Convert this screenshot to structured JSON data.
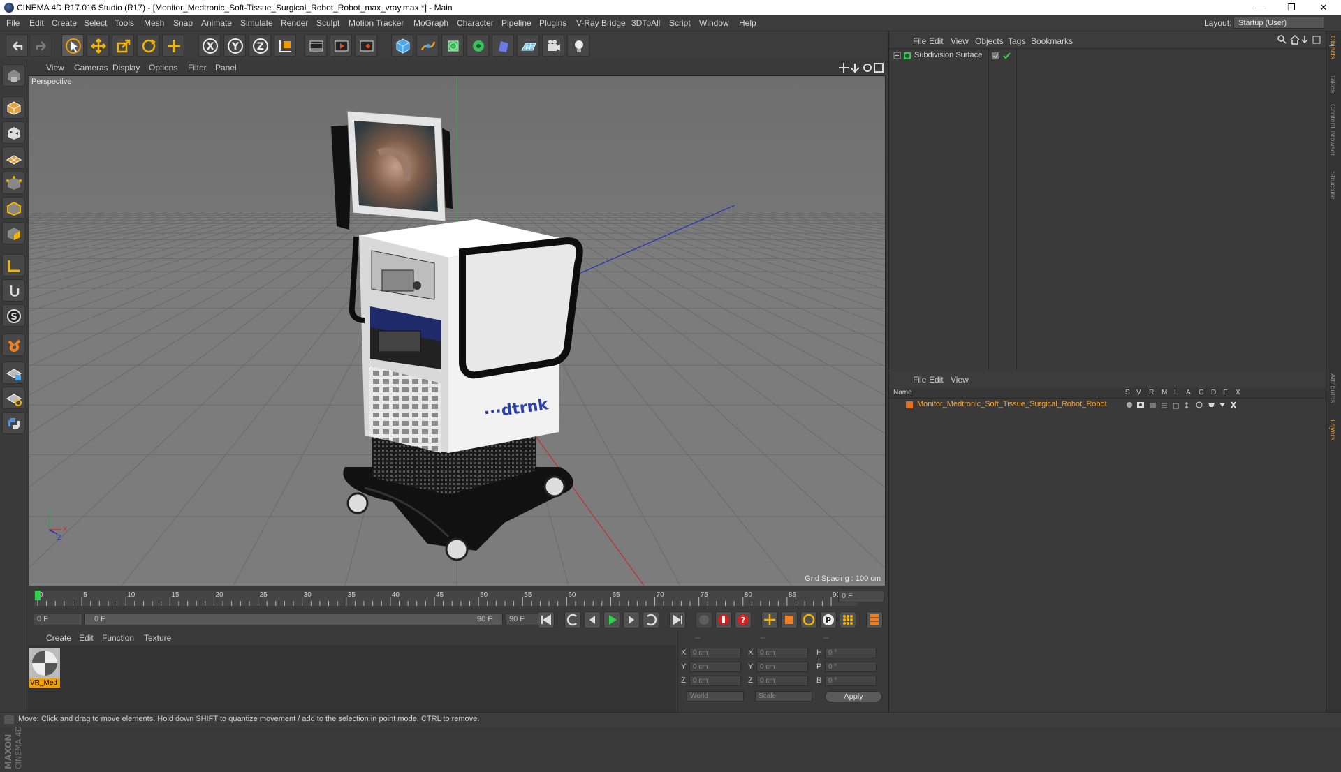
{
  "window": {
    "title": "CINEMA 4D R17.016 Studio (R17) - [Monitor_Medtronic_Soft-Tissue_Surgical_Robot_Robot_max_vray.max *] - Main",
    "minimize": "—",
    "restore": "❐",
    "close": "✕"
  },
  "menu": {
    "items": [
      "File",
      "Edit",
      "Create",
      "Select",
      "Tools",
      "Mesh",
      "Snap",
      "Animate",
      "Simulate",
      "Render",
      "Sculpt",
      "Motion Tracker",
      "MoGraph",
      "Character",
      "Pipeline",
      "Plugins",
      "V-Ray Bridge",
      "3DToAll",
      "Script",
      "Window",
      "Help"
    ],
    "layout_label": "Layout:",
    "layout_value": "Startup (User)"
  },
  "toolbar": {
    "icons": [
      "undo-icon",
      "redo-icon",
      "select-arrow-icon",
      "move-icon",
      "scale-icon",
      "rotate-icon",
      "last-tool-icon",
      "x-axis-icon",
      "y-axis-icon",
      "z-axis-icon",
      "coordinate-system-icon",
      "render-view-icon",
      "render-picture-viewer-icon",
      "edit-render-settings-icon",
      "cube-primitive-icon",
      "spline-pen-icon",
      "nurbs-icon",
      "array-icon",
      "deformer-icon",
      "floor-icon",
      "camera-icon",
      "light-icon"
    ]
  },
  "viewport": {
    "menu": [
      "View",
      "Cameras",
      "Display",
      "Options",
      "Filter",
      "Panel"
    ],
    "label": "Perspective",
    "grid_spacing": "Grid Spacing : 100 cm",
    "logo_text": "···dtrnk"
  },
  "timeline": {
    "ticks": [
      "0",
      "5",
      "10",
      "15",
      "20",
      "25",
      "30",
      "35",
      "40",
      "45",
      "50",
      "55",
      "60",
      "65",
      "70",
      "75",
      "80",
      "85",
      "90"
    ],
    "current_frame": "0 F",
    "start_field": "0 F",
    "range_start": "0 F",
    "range_end": "90 F",
    "end_field": "90 F"
  },
  "materials": {
    "menu": [
      "Create",
      "Edit",
      "Function",
      "Texture"
    ],
    "items": [
      {
        "label": "VR_Med"
      }
    ]
  },
  "coords": {
    "headers": [
      "--",
      "--",
      "--"
    ],
    "rows": [
      {
        "a": "X",
        "av": "0 cm",
        "b": "X",
        "bv": "0 cm",
        "c": "H",
        "cv": "0 °"
      },
      {
        "a": "Y",
        "av": "0 cm",
        "b": "Y",
        "bv": "0 cm",
        "c": "P",
        "cv": "0 °"
      },
      {
        "a": "Z",
        "av": "0 cm",
        "b": "Z",
        "bv": "0 cm",
        "c": "B",
        "cv": "0 °"
      }
    ],
    "world": "World",
    "scale": "Scale",
    "apply": "Apply"
  },
  "objects": {
    "menu": [
      "File",
      "Edit",
      "View",
      "Objects",
      "Tags",
      "Bookmarks"
    ],
    "items": [
      {
        "name": "Subdivision Surface"
      }
    ]
  },
  "layers": {
    "menu": [
      "File",
      "Edit",
      "View"
    ],
    "header_name": "Name",
    "columns": [
      "S",
      "V",
      "R",
      "M",
      "L",
      "A",
      "G",
      "D",
      "E",
      "X"
    ],
    "items": [
      {
        "name": "Monitor_Medtronic_Soft_Tissue_Surgical_Robot_Robot",
        "color": "#e07020"
      }
    ]
  },
  "right_tabs": [
    "Objects",
    "Takes",
    "Content Browser",
    "Structure",
    "Attributes",
    "Layers"
  ],
  "status": "Move: Click and drag to move elements. Hold down SHIFT to quantize movement / add to the selection in point mode, CTRL to remove.",
  "colors": {
    "accent": "#f09a00",
    "layer_text": "#f0a030",
    "selection": "#6aa0e0"
  }
}
